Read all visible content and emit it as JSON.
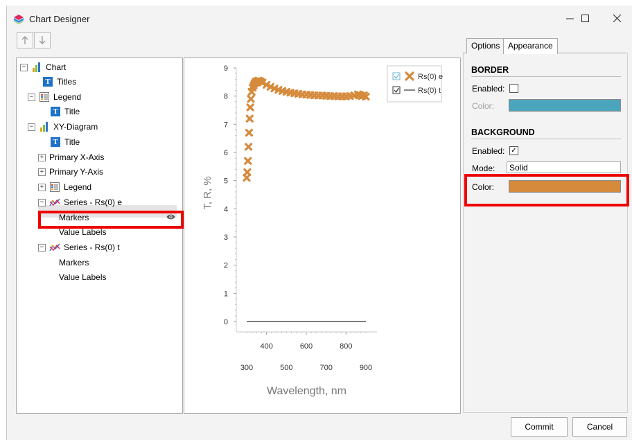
{
  "window": {
    "title": "Chart Designer"
  },
  "toolbar": {
    "up_icon": "arrow-up-icon",
    "down_icon": "arrow-down-icon"
  },
  "tree": {
    "chart": "Chart",
    "titles": "Titles",
    "legend": "Legend",
    "legend_title": "Title",
    "xy_diagram": "XY-Diagram",
    "xy_title": "Title",
    "primary_x_axis": "Primary X-Axis",
    "primary_y_axis": "Primary Y-Axis",
    "xy_legend": "Legend",
    "series1": "Series - Rs(0) e",
    "series1_markers": "Markers",
    "series1_value_labels": "Value Labels",
    "series2": "Series - Rs(0) t",
    "series2_markers": "Markers",
    "series2_value_labels": "Value Labels"
  },
  "chart_data": {
    "type": "scatter",
    "title": "",
    "xlabel": "Wavelength, nm",
    "ylabel": "T, R, %",
    "y_ticks": [
      "0",
      "1",
      "2",
      "3",
      "4",
      "5",
      "6",
      "7",
      "8",
      "9"
    ],
    "x_ticks_upper": [
      "400",
      "600",
      "800"
    ],
    "x_ticks_lower": [
      "300",
      "500",
      "700",
      "900"
    ],
    "xlim": [
      300,
      900
    ],
    "ylim": [
      0,
      9
    ],
    "legend": {
      "position": "top-right",
      "entries": [
        "Rs(0) e",
        "Rs(0) t"
      ]
    },
    "series": [
      {
        "name": "Rs(0) e",
        "marker": "x",
        "color": "#d58a3c",
        "points": [
          [
            300,
            5.1
          ],
          [
            303,
            5.3
          ],
          [
            306,
            5.7
          ],
          [
            309,
            6.2
          ],
          [
            312,
            6.7
          ],
          [
            315,
            7.2
          ],
          [
            318,
            7.6
          ],
          [
            321,
            7.9
          ],
          [
            325,
            8.15
          ],
          [
            330,
            8.3
          ],
          [
            335,
            8.38
          ],
          [
            340,
            8.45
          ],
          [
            345,
            8.5
          ],
          [
            350,
            8.53
          ],
          [
            360,
            8.55
          ],
          [
            370,
            8.52
          ],
          [
            380,
            8.48
          ],
          [
            400,
            8.4
          ],
          [
            420,
            8.33
          ],
          [
            440,
            8.27
          ],
          [
            460,
            8.22
          ],
          [
            480,
            8.18
          ],
          [
            500,
            8.15
          ],
          [
            520,
            8.12
          ],
          [
            540,
            8.1
          ],
          [
            560,
            8.08
          ],
          [
            580,
            8.06
          ],
          [
            600,
            8.05
          ],
          [
            620,
            8.04
          ],
          [
            640,
            8.03
          ],
          [
            660,
            8.02
          ],
          [
            680,
            8.02
          ],
          [
            700,
            8.01
          ],
          [
            720,
            8.0
          ],
          [
            740,
            8.0
          ],
          [
            760,
            7.99
          ],
          [
            780,
            7.99
          ],
          [
            800,
            7.99
          ],
          [
            820,
            8.0
          ],
          [
            840,
            8.02
          ],
          [
            860,
            8.06
          ],
          [
            870,
            8.04
          ],
          [
            880,
            8.0
          ],
          [
            890,
            8.03
          ],
          [
            900,
            7.98
          ]
        ]
      },
      {
        "name": "Rs(0) t",
        "marker": "line",
        "color": "#333333",
        "points": [
          [
            300,
            0
          ],
          [
            900,
            0
          ]
        ]
      }
    ]
  },
  "tabs": {
    "options": "Options",
    "appearance": "Appearance"
  },
  "border": {
    "heading": "BORDER",
    "enabled_label": "Enabled:",
    "enabled": false,
    "color_label": "Color:",
    "color": "#4ba5bc"
  },
  "background": {
    "heading": "BACKGROUND",
    "enabled_label": "Enabled:",
    "enabled": true,
    "mode_label": "Mode:",
    "mode_value": "Solid",
    "color_label": "Color:",
    "color": "#d58a3c"
  },
  "buttons": {
    "commit": "Commit",
    "cancel": "Cancel"
  },
  "colors": {
    "highlight": "#ee0000",
    "accent": "#1e73c8"
  }
}
